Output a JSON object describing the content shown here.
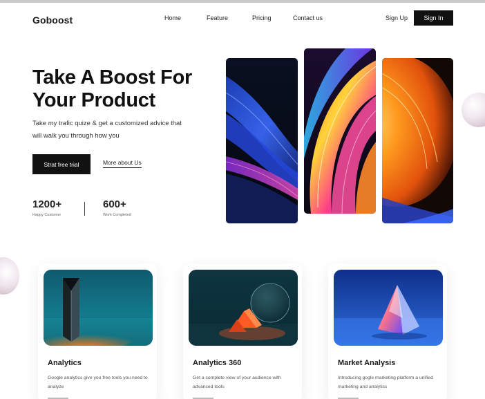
{
  "brand": {
    "name": "Goboost"
  },
  "nav": {
    "links": [
      "Home",
      "Feature",
      "Pricing",
      "Contact us"
    ],
    "signup_label": "Sign Up",
    "signin_label": "Sign In"
  },
  "hero": {
    "title": "Take A Boost For Your Product",
    "subtitle": "Take my trafic quize & get a customized advice that will walk you through how you",
    "primary_cta": "Strat free trial",
    "secondary_cta": "More about Us",
    "stats": [
      {
        "value": "1200+",
        "label": "Happy Customer"
      },
      {
        "value": "600+",
        "label": "Work Completed"
      }
    ]
  },
  "cards": [
    {
      "title": "Analytics",
      "desc": "Google analytics give you free tools you need to analyze"
    },
    {
      "title": "Analytics 360",
      "desc": "Get a complete view of your audience with advanced tools"
    },
    {
      "title": "Market Analysis",
      "desc": "Introducing gogle marketing platform a unified marketing and analytics"
    }
  ],
  "colors": {
    "primary": "#111111",
    "background": "#ffffff"
  }
}
